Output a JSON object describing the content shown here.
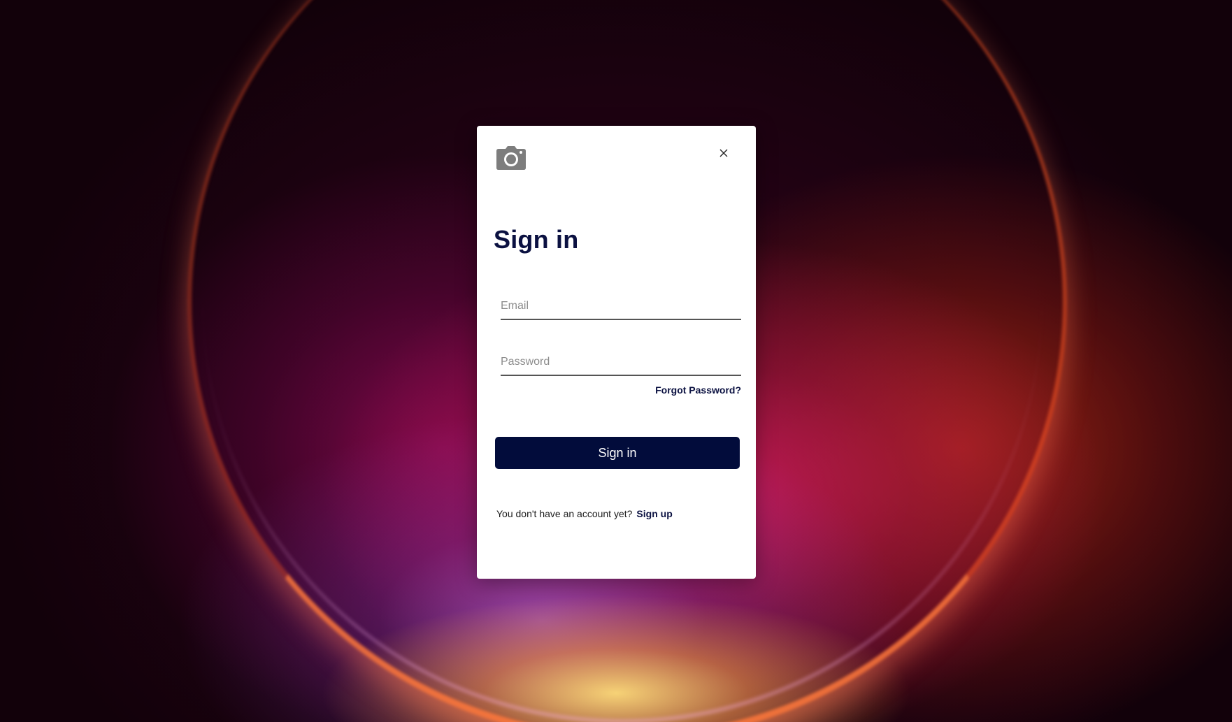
{
  "background": {
    "accent_colors": [
      "#12010a",
      "#8b0a5a",
      "#d0205a",
      "#c83010",
      "#ffb060"
    ]
  },
  "dialog": {
    "logo_icon": "camera-icon",
    "close_icon": "close-icon",
    "title": "Sign in",
    "email": {
      "value": "",
      "placeholder": "Email"
    },
    "password": {
      "value": "",
      "placeholder": "Password"
    },
    "forgot_password_label": "Forgot Password?",
    "signin_button_label": "Sign in",
    "signup_prompt": "You don't have an account yet?",
    "signup_link_label": "Sign up",
    "colors": {
      "primary": "#020c3b",
      "title_text": "#0b1141"
    }
  }
}
